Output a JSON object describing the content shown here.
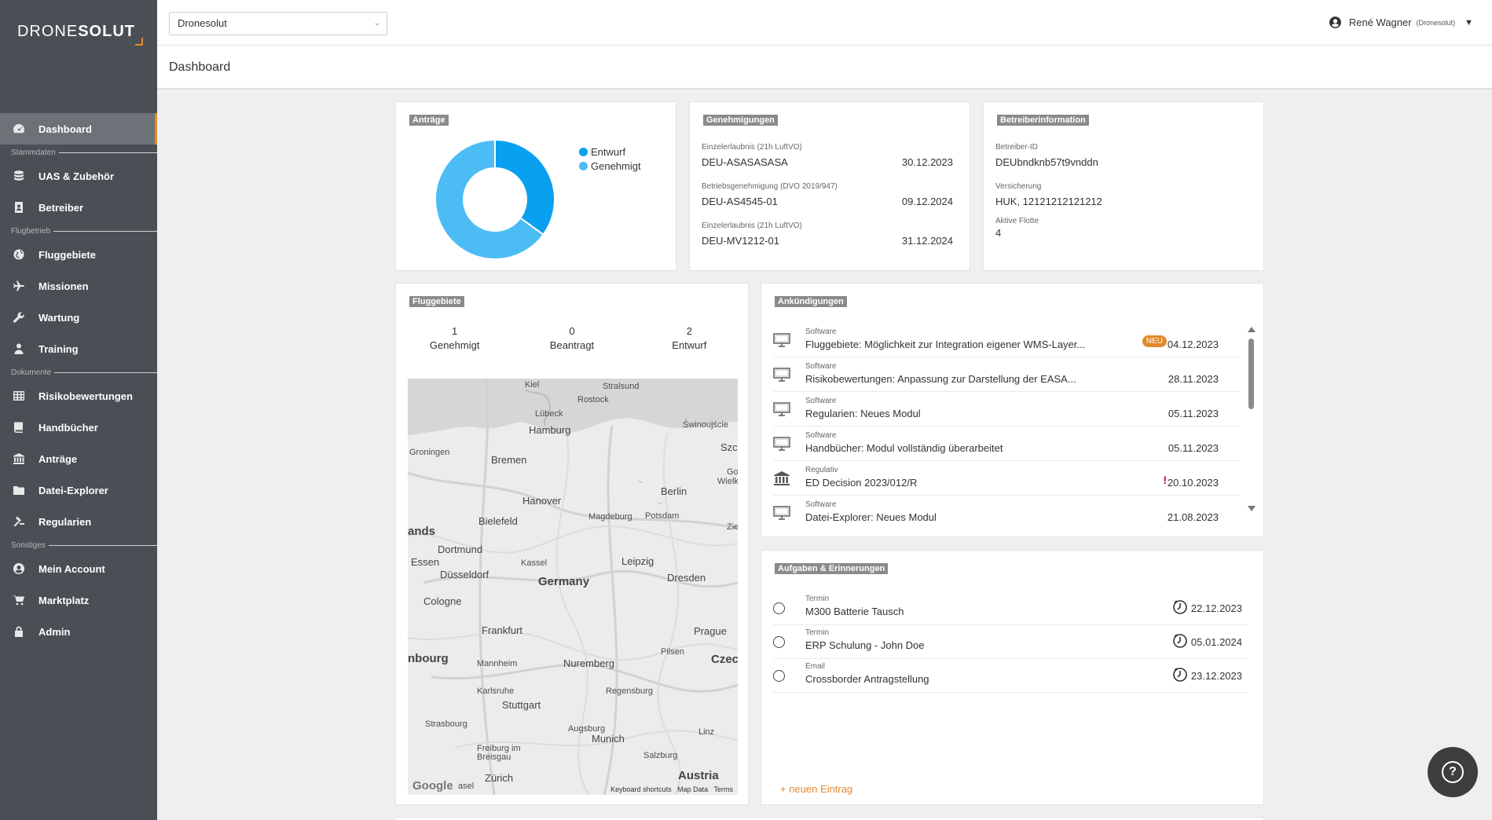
{
  "app": {
    "logo_light": "DRONE",
    "logo_bold": "SOLUT",
    "company": "Dronesolut",
    "user_name": "René Wagner",
    "user_org": "(Dronesolut)",
    "page_title": "Dashboard",
    "accent": "#e08a2c"
  },
  "nav": {
    "dashboard": "Dashboard",
    "sec_stammdaten": "Stammdaten",
    "uas": "UAS & Zubehör",
    "betreiber": "Betreiber",
    "sec_flugbetrieb": "Flugbetrieb",
    "fluggebiete": "Fluggebiete",
    "missionen": "Missionen",
    "wartung": "Wartung",
    "training": "Training",
    "sec_dokumente": "Dokumente",
    "risiko": "Risikobewertungen",
    "handbuecher": "Handbücher",
    "antraege": "Anträge",
    "datei": "Datei-Explorer",
    "regularien": "Regularien",
    "sec_sonstiges": "Sonstiges",
    "account": "Mein Account",
    "markt": "Marktplatz",
    "admin": "Admin"
  },
  "antraege": {
    "title": "Anträge",
    "legend": [
      "Entwurf",
      "Genehmigt"
    ],
    "colors": [
      "#0aa0f0",
      "#4cbcf5"
    ],
    "chart_data": {
      "type": "pie",
      "labels": [
        "Entwurf",
        "Genehmigt"
      ],
      "values": [
        35,
        65
      ]
    }
  },
  "genehmigungen": {
    "title": "Genehmigungen",
    "items": [
      {
        "label": "Einzelerlaubnis (21h LuftVO)",
        "id": "DEU-ASASASASA",
        "date": "30.12.2023"
      },
      {
        "label": "Betriebsgenehmigung (DVO 2019/947)",
        "id": "DEU-AS4545-01",
        "date": "09.12.2024"
      },
      {
        "label": "Einzelerlaubnis (21h LuftVO)",
        "id": "DEU-MV1212-01",
        "date": "31.12.2024"
      }
    ]
  },
  "betreiber": {
    "title": "Betreiberinformation",
    "id_label": "Betreiber-ID",
    "id_value": "DEUbndknb57t9vnddn",
    "vers_label": "Versicherung",
    "vers_value": "HUK, 12121212121212",
    "flotte_label": "Aktive Flotte",
    "flotte_value": "4"
  },
  "fluggebiete": {
    "title": "Fluggebiete",
    "stats": [
      {
        "count": "1",
        "label": "Genehmigt"
      },
      {
        "count": "0",
        "label": "Beantragt"
      },
      {
        "count": "2",
        "label": "Entwurf"
      }
    ],
    "map": {
      "labels": [
        "Kiel",
        "Stralsund",
        "Rostock",
        "Lübeck",
        "Świnoujście",
        "Hamburg",
        "Groningen",
        "Bremen",
        "Szc",
        "Go",
        "Wielk",
        "Berlin",
        "Hanover",
        "Potsdam",
        "Magdeburg",
        "Bielefeld",
        "Zie",
        "ands",
        "Dortmund",
        "Essen",
        "Düsseldorf",
        "Kassel",
        "Leipzig",
        "Germany",
        "Dresden",
        "Cologne",
        "Frankfurt",
        "Prague",
        "Pilsen",
        "nbourg",
        "Mannheim",
        "Nuremberg",
        "Czec",
        "Karlsruhe",
        "Regensburg",
        "Stuttgart",
        "Strasbourg",
        "Augsburg",
        "Munich",
        "Linz",
        "Freiburg im Breisgau",
        "Salzburg",
        "Zürich",
        "Austria",
        "asel"
      ],
      "footer": [
        "Keyboard shortcuts",
        "Map Data",
        "Terms"
      ],
      "google": "Google"
    }
  },
  "ankuendigungen": {
    "title": "Ankündigungen",
    "badge": "NEU",
    "items": [
      {
        "cat": "Software",
        "title": "Fluggebiete: Möglichkeit zur Integration eigener WMS-Layer...",
        "date": "04.12.2023",
        "icon": "monitor-icon",
        "flag": "neu"
      },
      {
        "cat": "Software",
        "title": "Risikobewertungen: Anpassung zur Darstellung der EASA...",
        "date": "28.11.2023",
        "icon": "monitor-icon",
        "flag": ""
      },
      {
        "cat": "Software",
        "title": "Regularien: Neues Modul",
        "date": "05.11.2023",
        "icon": "monitor-icon",
        "flag": ""
      },
      {
        "cat": "Software",
        "title": "Handbücher: Modul vollständig überarbeitet",
        "date": "05.11.2023",
        "icon": "monitor-icon",
        "flag": ""
      },
      {
        "cat": "Regulativ",
        "title": "ED Decision 2023/012/R",
        "date": "20.10.2023",
        "icon": "bank-icon",
        "flag": "!"
      },
      {
        "cat": "Software",
        "title": "Datei-Explorer: Neues Modul",
        "date": "21.08.2023",
        "icon": "monitor-icon",
        "flag": ""
      }
    ]
  },
  "aufgaben": {
    "title": "Aufgaben & Erinnerungen",
    "items": [
      {
        "cat": "Termin",
        "title": "M300 Batterie Tausch",
        "date": "22.12.2023"
      },
      {
        "cat": "Termin",
        "title": "ERP Schulung  - John Doe",
        "date": "05.01.2024"
      },
      {
        "cat": "Email",
        "title": "Crossborder Antragstellung",
        "date": "23.12.2023"
      }
    ],
    "add_label": "+ neuen Eintrag"
  },
  "help": {
    "label": "?"
  }
}
